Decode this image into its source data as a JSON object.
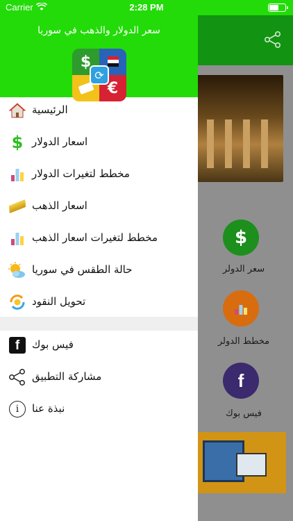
{
  "status_bar": {
    "carrier": "Carrier",
    "time": "2:28 PM"
  },
  "drawer": {
    "title": "سعر الدولار والذهب في سوريا",
    "menu": [
      {
        "label": "الرئيسية",
        "icon": "home-icon"
      },
      {
        "label": "اسعار الدولار",
        "icon": "dollar-icon"
      },
      {
        "label": "مخطط لتغيرات الدولار",
        "icon": "bar-chart-icon"
      },
      {
        "label": "اسعار الذهب",
        "icon": "gold-bar-icon"
      },
      {
        "label": "مخطط لتغيرات اسعار الذهب",
        "icon": "bar-chart-icon"
      },
      {
        "label": "حالة الطقس في سوريا",
        "icon": "weather-icon"
      },
      {
        "label": "تحويل النقود",
        "icon": "currency-exchange-icon"
      }
    ],
    "secondary_menu": [
      {
        "label": "فيس بوك",
        "icon": "facebook-icon"
      },
      {
        "label": "مشاركة التطبيق",
        "icon": "share-icon"
      },
      {
        "label": "نبذة عنا",
        "icon": "info-icon"
      }
    ]
  },
  "background": {
    "tiles": [
      {
        "label": "سعر الدولر",
        "color": "#1c8f1c",
        "icon": "dollar-icon"
      },
      {
        "label": "مخطط الدولر",
        "color": "#d96c0e",
        "icon": "bar-chart-icon"
      },
      {
        "label": "فيس بوك",
        "color": "#3c2a6e",
        "icon": "facebook-icon"
      }
    ]
  },
  "colors": {
    "accent": "#23db08",
    "toolbar_dim": "#129412"
  }
}
